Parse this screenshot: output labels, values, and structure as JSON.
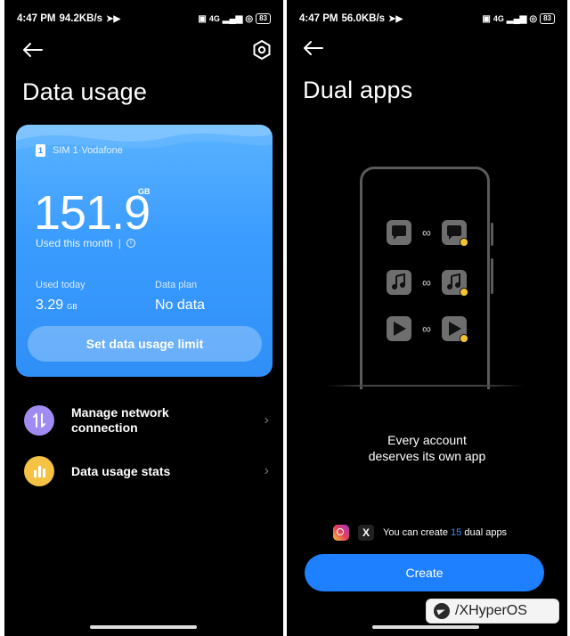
{
  "left": {
    "status": {
      "time": "4:47 PM",
      "speed": "94.2KB/s",
      "network": "4G",
      "battery": "83"
    },
    "title": "Data usage",
    "card": {
      "sim_label": "SIM 1·Vodafone",
      "sim_chip": "1",
      "used_value": "151.9",
      "used_unit": "GB",
      "used_caption": "Used this month",
      "info_icon": "i",
      "today_label": "Used today",
      "today_value": "3.29",
      "today_unit": "GB",
      "plan_label": "Data plan",
      "plan_value": "No data",
      "limit_button": "Set data usage limit"
    },
    "rows": [
      {
        "label_line1": "Manage network",
        "label_line2": "connection",
        "icon": "arrows-updown-icon",
        "color": "#a08cf0"
      },
      {
        "label_line1": "Data usage stats",
        "label_line2": "",
        "icon": "bar-chart-icon",
        "color": "#f6c244"
      }
    ],
    "chevron": "›"
  },
  "right": {
    "status": {
      "time": "4:47 PM",
      "speed": "56.0KB/s",
      "network": "4G",
      "battery": "83"
    },
    "title": "Dual apps",
    "infinity": "∞",
    "tagline_line1": "Every account",
    "tagline_line2": "deserves its own app",
    "create_prefix": "You can create ",
    "create_count": "15",
    "create_suffix": " dual apps",
    "x_logo": "X",
    "create_button": "Create"
  },
  "watermark": "/XHyperOS",
  "colors": {
    "accent": "#1e7fff",
    "card_blue": "#3b9cff"
  }
}
